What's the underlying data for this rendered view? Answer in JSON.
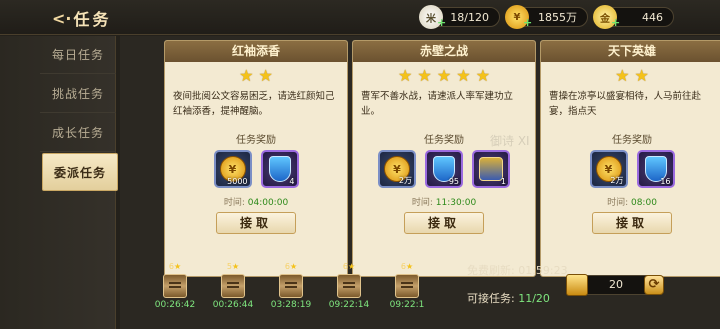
{
  "header": {
    "title": "任务",
    "back_arrow": "<·"
  },
  "resources": [
    {
      "icon": "rice-icon",
      "value": "18/120"
    },
    {
      "icon": "coin-icon",
      "value": "1855万"
    },
    {
      "icon": "gold-ingot-icon",
      "value": "446"
    }
  ],
  "tabs": [
    {
      "label": "每日任务"
    },
    {
      "label": "挑战任务"
    },
    {
      "label": "成长任务"
    },
    {
      "label": "委派任务",
      "active": true
    }
  ],
  "cards": [
    {
      "title": "红袖添香",
      "stars": "★ ★",
      "desc": "夜间批阅公文容易困乏，请选红颜知己红袖添香，提神醒脑。",
      "reward_label": "任务奖励",
      "rewards": [
        {
          "type": "coin",
          "qty": "5000"
        },
        {
          "type": "shield",
          "qty": "4"
        }
      ],
      "time_label": "时间:",
      "time": "04:00:00",
      "button": "接取"
    },
    {
      "title": "赤壁之战",
      "stars": "★ ★ ★ ★ ★",
      "desc": "曹军不善水战，请速派人率军建功立业。",
      "reward_label": "任务奖励",
      "rewards": [
        {
          "type": "coin",
          "qty": "2万"
        },
        {
          "type": "shield",
          "qty": "95"
        },
        {
          "type": "armor",
          "qty": "1"
        }
      ],
      "time_label": "时间:",
      "time": "11:30:00",
      "button": "接取"
    },
    {
      "title": "天下英雄",
      "stars": "★ ★",
      "desc": "曹操在凉亭以盛宴相待，人马前往赴宴，指点天",
      "reward_label": "任务奖励",
      "rewards": [
        {
          "type": "coin",
          "qty": "2万"
        },
        {
          "type": "shield",
          "qty": "16"
        }
      ],
      "time_label": "时间:",
      "time": "08:00",
      "button": "接取"
    }
  ],
  "slots": [
    {
      "level": "6",
      "time": "00:26:42"
    },
    {
      "level": "5",
      "time": "00:26:44"
    },
    {
      "level": "6",
      "time": "03:28:19"
    },
    {
      "level": "6",
      "time": "09:22:14"
    },
    {
      "level": "6",
      "time": "09:22:1"
    }
  ],
  "footer": {
    "refresh_label": "免费刷新:",
    "refresh_time": "01:59:23",
    "accept_label": "可接任务:",
    "accept_value": "11/20",
    "ticket_count": "20"
  },
  "watermark": "御诗 XI"
}
